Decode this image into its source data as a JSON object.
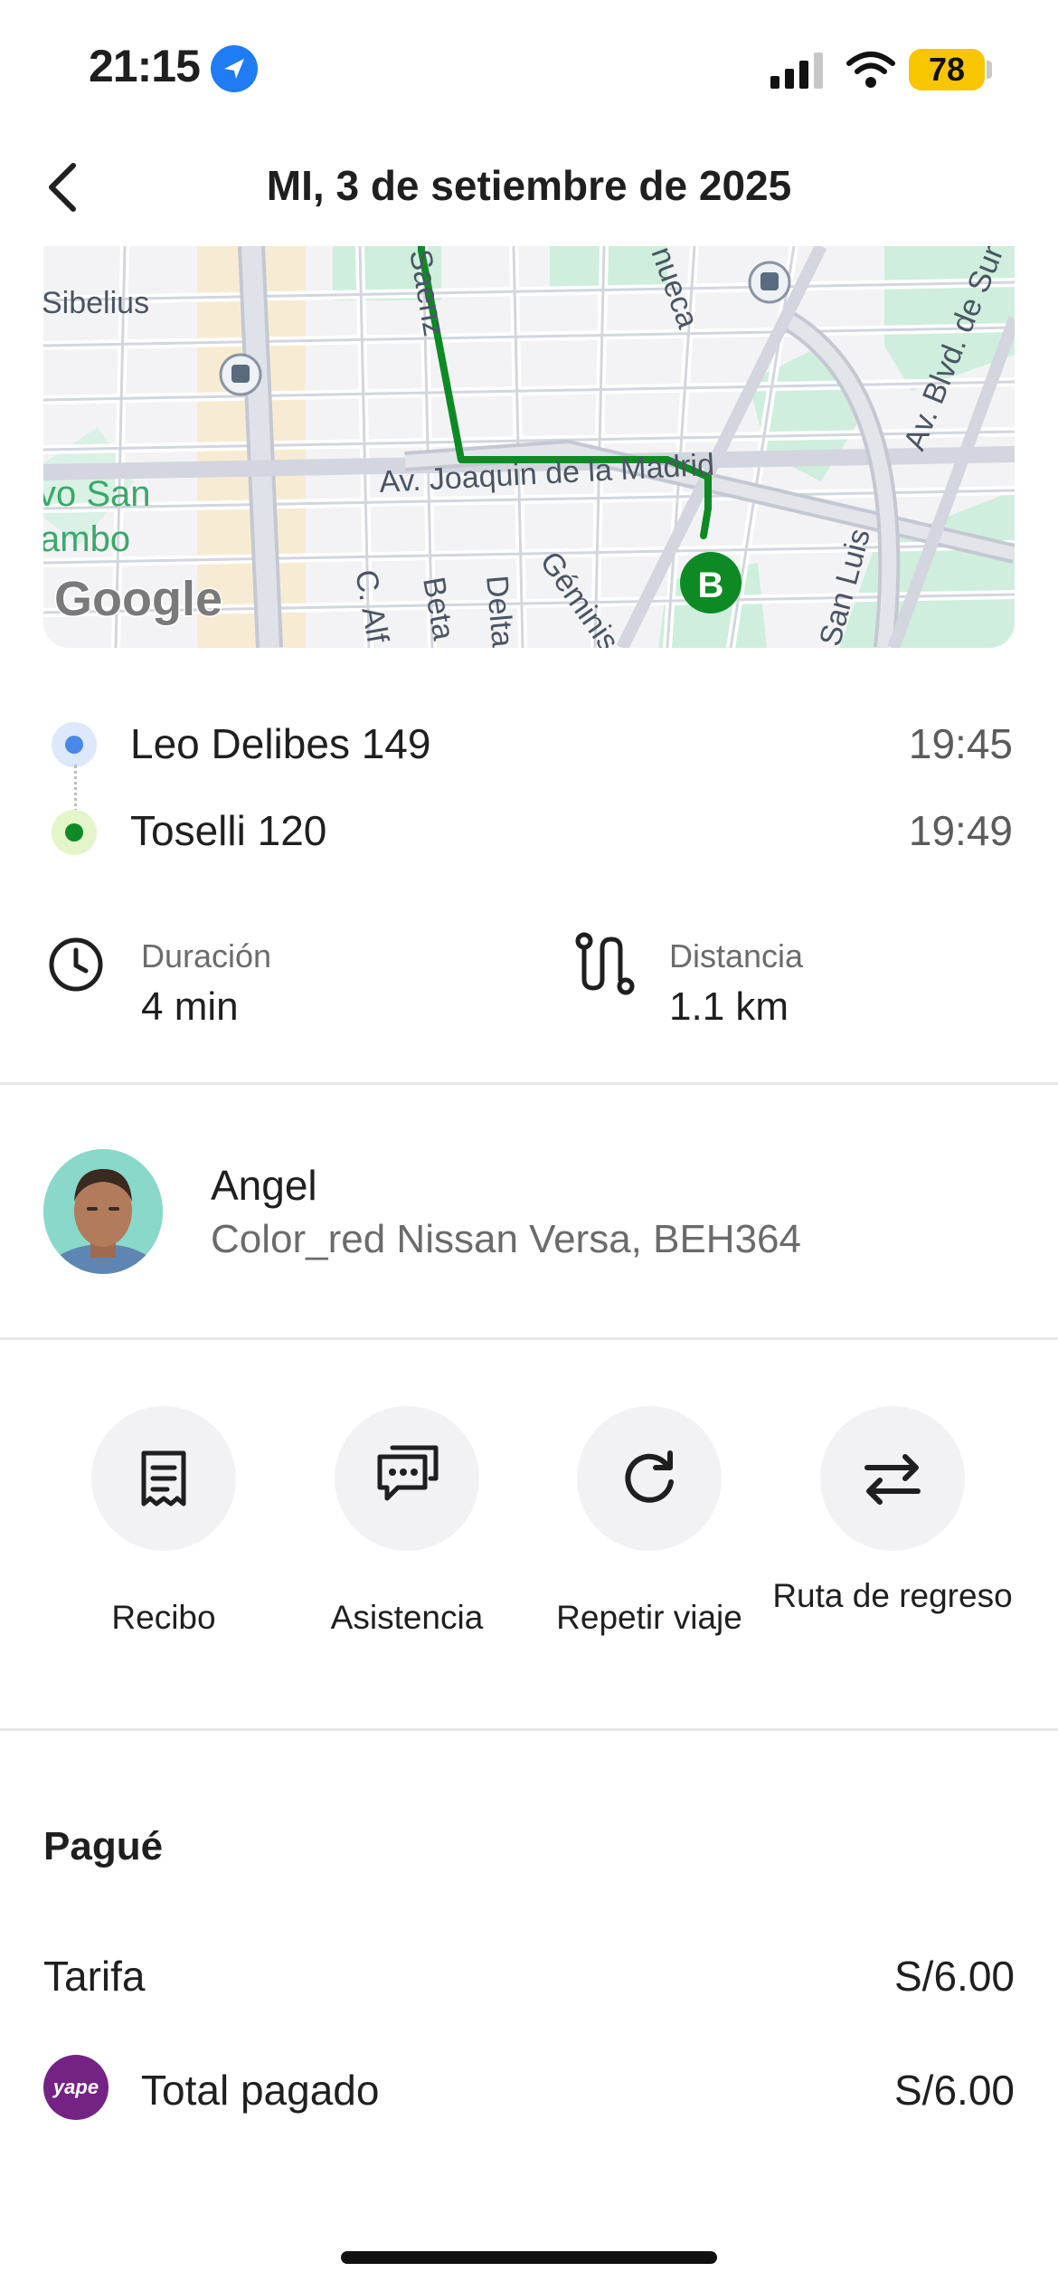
{
  "status_bar": {
    "time": "21:15",
    "battery": "78",
    "location_icon": "location-arrow-icon",
    "signal_icon": "cellular-signal-icon",
    "wifi_icon": "wifi-icon"
  },
  "header": {
    "title": "MI, 3 de setiembre de 2025",
    "back_icon": "chevron-left-icon"
  },
  "map": {
    "labels": {
      "sibelius": "Sibelius",
      "sanz": "Saenz",
      "nueca": "nueca",
      "av_joaquin": "Av. Joaquin de la Madrid",
      "blvd": "Av. Blvd. de Sur",
      "san_luis": "San Luis",
      "vo_san": "vo San",
      "ambo": "ambo",
      "c_alf": "C. Alf",
      "beta": "Beta",
      "delta": "Delta",
      "geminis": "Géminis",
      "google": "Google",
      "marker_b": "B"
    },
    "route_color": "#0d8a24"
  },
  "route": {
    "origin": {
      "name": "Leo Delibes 149",
      "time": "19:45",
      "color": "#4a89e8"
    },
    "destination": {
      "name": "Toselli 120",
      "time": "19:49",
      "color": "#0d8a24"
    }
  },
  "stats": {
    "duration": {
      "label": "Duración",
      "value": "4 min",
      "icon": "clock-icon"
    },
    "distance": {
      "label": "Distancia",
      "value": "1.1 km",
      "icon": "route-icon"
    }
  },
  "driver": {
    "name": "Angel",
    "car": "Color_red Nissan Versa, BEH364"
  },
  "actions": [
    {
      "label": "Recibo",
      "icon": "receipt-icon"
    },
    {
      "label": "Asistencia",
      "icon": "chat-bubbles-icon"
    },
    {
      "label": "Repetir viaje",
      "icon": "repeat-icon"
    },
    {
      "label": "Ruta de regreso",
      "icon": "swap-arrows-icon"
    }
  ],
  "payment": {
    "title": "Pagué",
    "fare_label": "Tarifa",
    "fare_value": "S/6.00",
    "total_label": "Total pagado",
    "total_value": "S/6.00",
    "method_logo": "yape"
  }
}
